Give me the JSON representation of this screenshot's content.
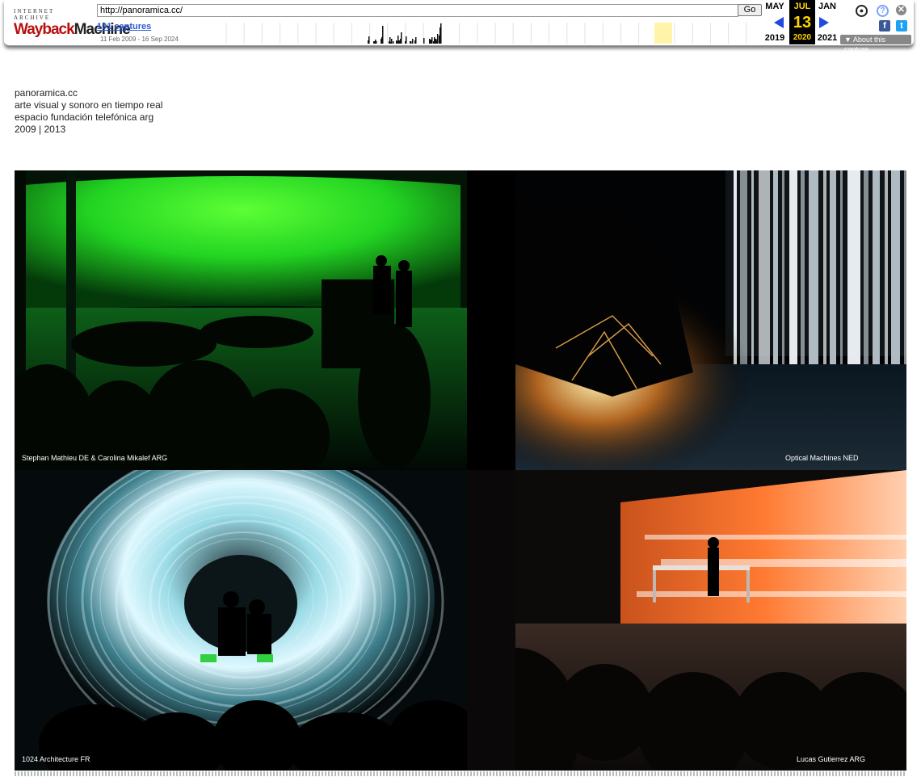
{
  "wayback": {
    "logo_top": "INTERNET ARCHIVE",
    "logo_wayback": "Wayback",
    "logo_machine": "Machine",
    "url": "http://panoramica.cc/",
    "go_label": "Go",
    "captures_label": "101 captures",
    "captures_range": "11 Feb 2009 - 16 Sep 2024",
    "prev_month": "MAY",
    "prev_year": "2019",
    "current_month": "JUL",
    "current_day": "13",
    "current_year": "2020",
    "next_month": "JAN",
    "next_year": "2021",
    "about_label": "About this capture",
    "icons": [
      "user-icon",
      "help-icon",
      "close-icon",
      "facebook-icon",
      "twitter-icon"
    ],
    "accent_color": "#ffd400",
    "arrow_color": "#1f4be0"
  },
  "site": {
    "title": "panoramica.cc",
    "line2": "arte visual y sonoro en tiempo real",
    "line3": "espacio fundación telefónica arg",
    "line4": "2009 | 2013"
  },
  "gallery": {
    "captions": [
      "Stephan Mathieu DE & Carolina Mikalef ARG",
      "Optical Machines NED",
      "1024 Architecture FR",
      "Lucas Gutierrez ARG"
    ]
  }
}
